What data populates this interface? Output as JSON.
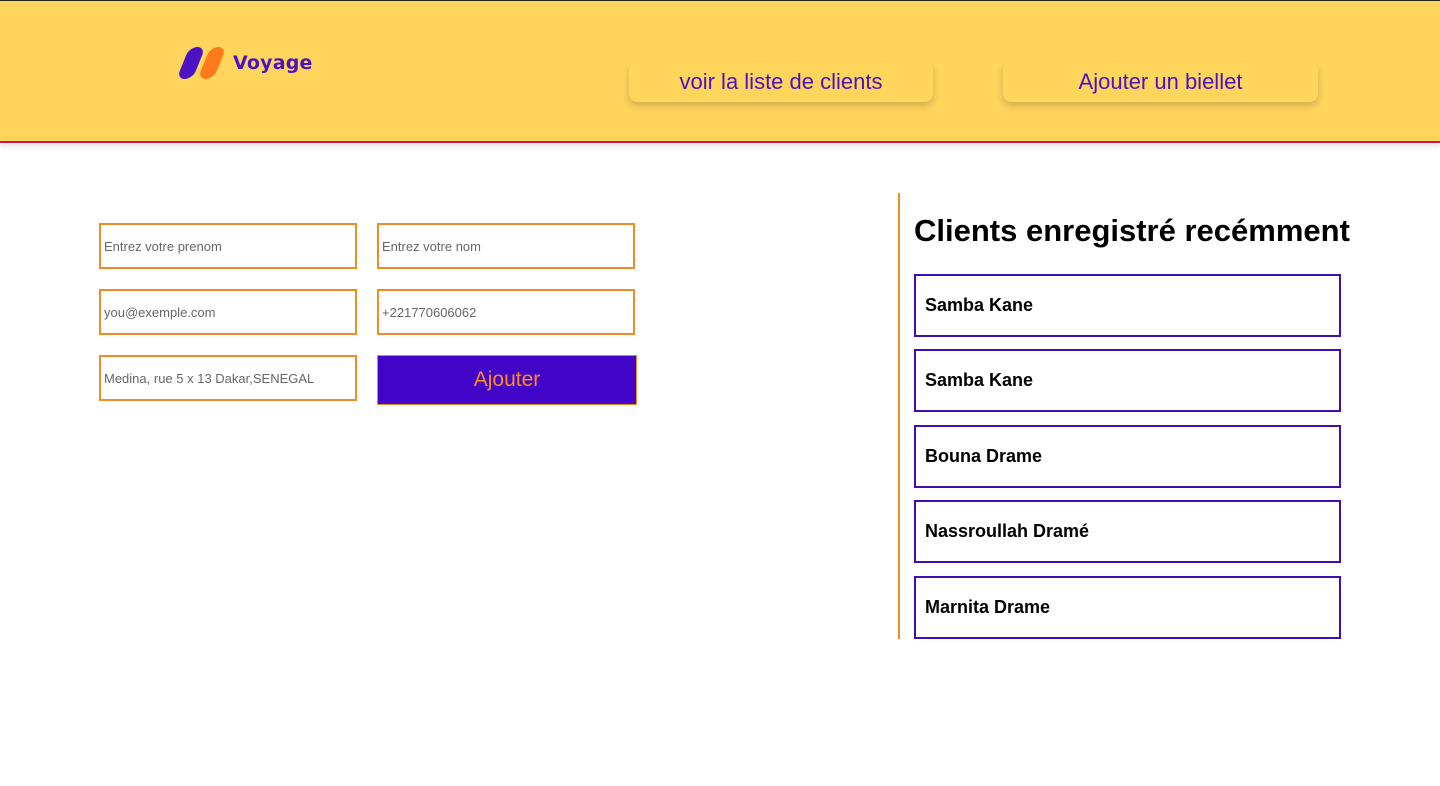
{
  "header": {
    "logo_text": "Voyage",
    "nav": {
      "clients_label": "voir la liste de clients",
      "billet_label": "Ajouter un biellet"
    }
  },
  "form": {
    "prenom_placeholder": "Entrez votre prenom",
    "nom_placeholder": "Entrez votre nom",
    "email_placeholder": "you@exemple.com",
    "telephone_placeholder": "+221770606062",
    "adresse_placeholder": "Medina, rue 5 x 13 Dakar,SENEGAL",
    "submit_label": "Ajouter"
  },
  "recent_clients": {
    "title": "Clients enregistré recémment",
    "items": [
      {
        "name": "Samba Kane"
      },
      {
        "name": "Samba Kane"
      },
      {
        "name": "Bouna Drame"
      },
      {
        "name": "Nassroullah Dramé"
      },
      {
        "name": "Marnita Drame"
      }
    ]
  },
  "colors": {
    "header_bg": "#ffd55b",
    "brand_purple": "#4304c9",
    "accent_orange": "#ef8a24",
    "card_border": "#3f0fb5"
  },
  "icons": {
    "logo": "voyage-logo-icon"
  }
}
